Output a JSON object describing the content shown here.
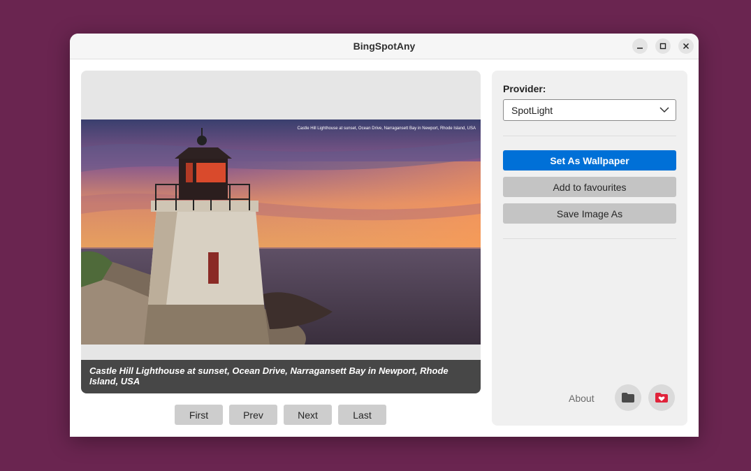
{
  "window": {
    "title": "BingSpotAny"
  },
  "image": {
    "caption": "Castle Hill Lighthouse at sunset, Ocean Drive, Narragansett Bay in Newport, Rhode Island, USA",
    "watermark": "Castle Hill Lighthouse at sunset, Ocean Drive, Narragansett Bay in Newport, Rhode Island, USA"
  },
  "navigation": {
    "first": "First",
    "prev": "Prev",
    "next": "Next",
    "last": "Last"
  },
  "provider": {
    "label": "Provider:",
    "selected": "SpotLight"
  },
  "actions": {
    "set_wallpaper": "Set As Wallpaper",
    "add_favourites": "Add to favourites",
    "save_image": "Save Image As"
  },
  "footer": {
    "about": "About",
    "folder_icon": "folder-icon",
    "favourites_folder_icon": "heart-folder-icon"
  },
  "colors": {
    "accent": "#0070d7",
    "desktop": "#6a2550",
    "favourite": "#e0233a"
  }
}
